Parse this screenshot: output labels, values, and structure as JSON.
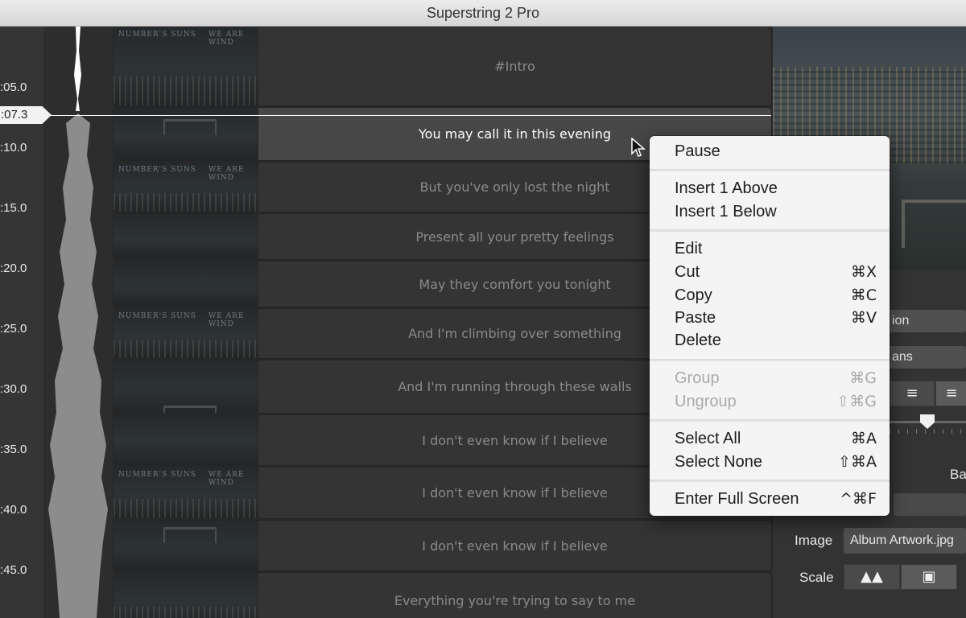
{
  "window": {
    "title": "Superstring 2 Pro"
  },
  "timeline": {
    "playhead": ":07.3",
    "ticks": [
      ":05.0",
      ":10.0",
      ":15.0",
      ":20.0",
      ":25.0",
      ":30.0",
      ":35.0",
      ":40.0",
      ":45.0"
    ]
  },
  "thumbnail_text": {
    "left": "NUMBER'S SUNS",
    "right": "WE ARE WIND"
  },
  "rows": [
    {
      "lyric": "#Intro",
      "selected": false
    },
    {
      "lyric": "You may call it in this evening",
      "selected": true
    },
    {
      "lyric": "But you've only lost the night",
      "selected": false
    },
    {
      "lyric": "Present all your pretty feelings",
      "selected": false
    },
    {
      "lyric": "May they comfort you tonight",
      "selected": false
    },
    {
      "lyric": "And I'm climbing over something",
      "selected": false
    },
    {
      "lyric": "And I'm running through these walls",
      "selected": false
    },
    {
      "lyric": "I don't even know if I believe",
      "selected": false
    },
    {
      "lyric": "I don't even know if I believe",
      "selected": false
    },
    {
      "lyric": "I don't even know if I believe",
      "selected": false
    },
    {
      "lyric": "Everything you're trying to say to me",
      "selected": false
    }
  ],
  "context_menu": {
    "pause": "Pause",
    "insert_above": "Insert 1 Above",
    "insert_below": "Insert 1 Below",
    "edit": "Edit",
    "cut": "Cut",
    "cut_sc": "⌘X",
    "copy": "Copy",
    "copy_sc": "⌘C",
    "paste": "Paste",
    "paste_sc": "⌘V",
    "delete": "Delete",
    "group": "Group",
    "group_sc": "⌘G",
    "ungroup": "Ungroup",
    "ungroup_sc": "⇧⌘G",
    "select_all": "Select All",
    "select_all_sc": "⌘A",
    "select_none": "Select None",
    "select_none_sc": "⇧⌘A",
    "full_screen": "Enter Full Screen",
    "full_screen_sc": "^⌘F"
  },
  "inspector": {
    "field1": "ion",
    "field2": "ans",
    "ba_label": "Ba",
    "image_label": "Image",
    "image_value": "Album Artwork.jpg",
    "scale_label": "Scale"
  },
  "icons": {
    "align_center": "align-center-icon",
    "align_right": "align-right-icon",
    "scale_fill": "scale-fill-icon",
    "scale_fit": "scale-fit-icon",
    "cursor": "mouse-pointer-icon"
  }
}
